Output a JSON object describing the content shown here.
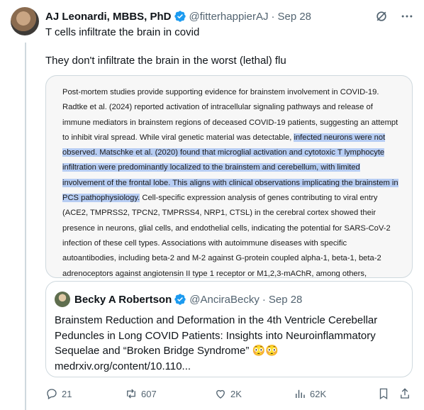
{
  "author": {
    "name": "AJ Leonardi, MBBS, PhD",
    "handle": "@fitterhappierAJ",
    "separator": "·",
    "date": "Sep 28"
  },
  "tweet": {
    "line1": "T cells infiltrate the brain in covid",
    "line2": "They don't infiltrate the brain in the worst (lethal) flu"
  },
  "media": {
    "text_before": "Post-mortem studies provide supporting evidence for brainstem involvement in COVID-19. Radtke et al. (2024) reported activation of intracellular signaling pathways and release of immune mediators in brainstem regions of deceased COVID-19 patients, suggesting an attempt to inhibit viral spread. While viral genetic material was detectable, ",
    "text_highlighted": "infected neurons were not observed. Matschke et al. (2020) found that microglial activation and cytotoxic T lymphocyte infiltration were predominantly localized to the brainstem and cerebellum, with limited involvement of the frontal lobe. This aligns with clinical observations implicating the brainstem in PCS pathophysiology.",
    "text_after": " Cell-specific expression analysis of genes contributing to viral entry (ACE2, TMPRSS2, TPCN2, TMPRSS4, NRP1, CTSL) in the cerebral cortex showed their presence in neurons, glial cells, and endothelial cells, indicating the potential for SARS-CoV-2 infection of these cell types. Associations with autoimmune diseases with specific autoantibodies, including beta-2 and M-2 against G-protein coupled alpha-1, beta-1, beta-2 adrenoceptors against angiotensin II type 1 receptor or M1,2,3-mAChR, among others,",
    "highlight_color": "#b7cdf3"
  },
  "quote": {
    "name": "Becky A Robertson",
    "handle": "@AnciraBecky",
    "separator": "·",
    "date": "Sep 28",
    "text": "Brainstem Reduction and Deformation in the 4th Ventricle Cerebellar Peduncles in Long COVID Patients: Insights into Neuroinflammatory Sequelae and “Broken Bridge Syndrome” 😳😳 medrxiv.org/content/10.110..."
  },
  "actions": {
    "replies": "21",
    "reposts": "607",
    "likes": "2K",
    "views": "62K"
  },
  "colors": {
    "verified": "#1d9bf0",
    "muted": "#536471",
    "border": "#cfd9de"
  },
  "icons": [
    "verified-badge-icon",
    "grok-icon",
    "more-icon",
    "reply-icon",
    "repost-icon",
    "like-icon",
    "views-icon",
    "bookmark-icon",
    "share-icon"
  ]
}
